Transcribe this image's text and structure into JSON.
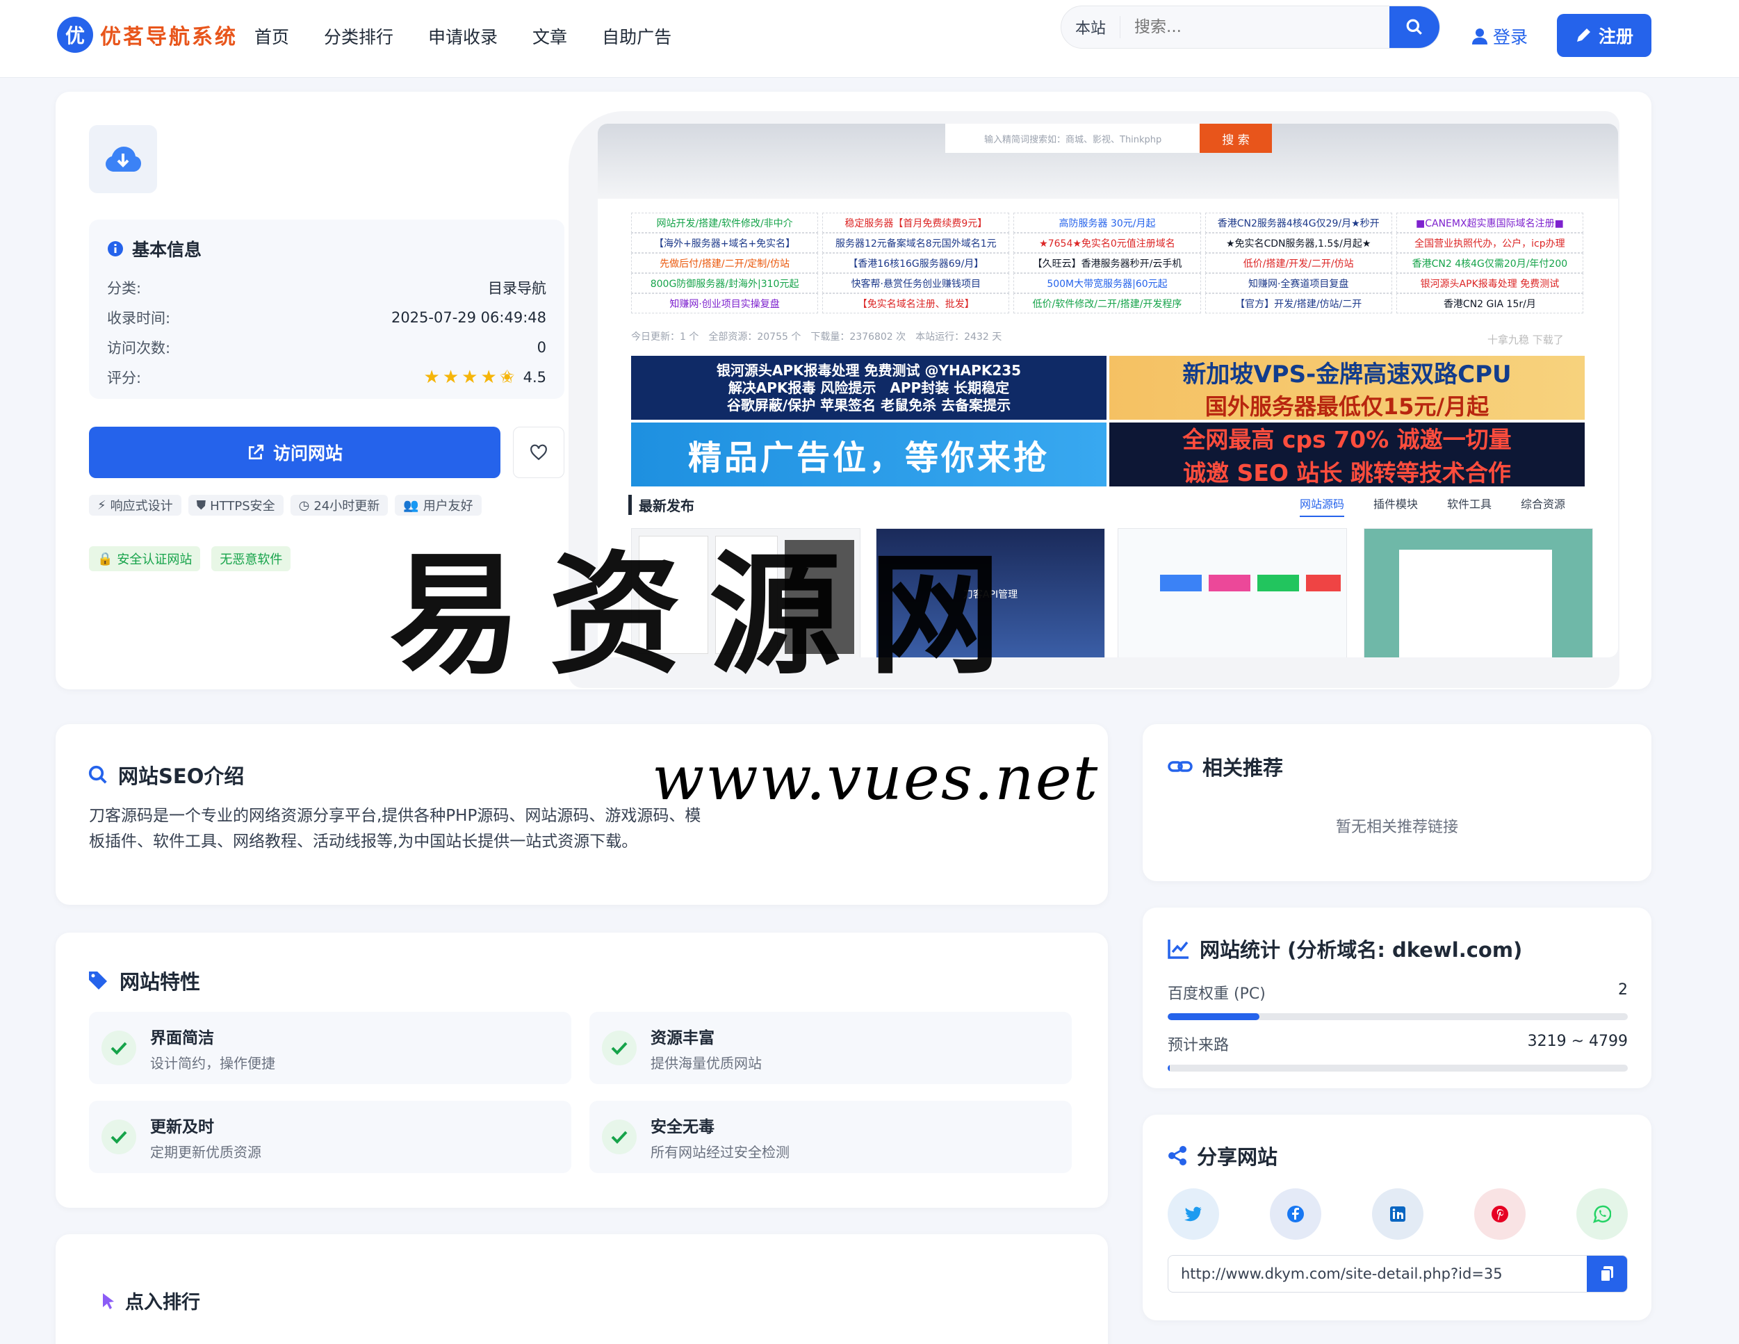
{
  "brand": {
    "badge": "优",
    "name": "优茗导航系统",
    "color": "#2563eb",
    "accent": "#e8551b"
  },
  "nav": [
    "首页",
    "分类排行",
    "申请收录",
    "文章",
    "自助广告"
  ],
  "search": {
    "scope": "本站",
    "placeholder": "搜索..."
  },
  "auth": {
    "login": "登录",
    "register": "注册"
  },
  "basic": {
    "title": "基本信息",
    "rows": [
      {
        "k": "分类:",
        "v": "目录导航"
      },
      {
        "k": "收录时间:",
        "v": "2025-07-29 06:49:48"
      },
      {
        "k": "访问次数:",
        "v": "0"
      },
      {
        "k": "评分:",
        "v": "4.5"
      }
    ],
    "rating": 4.5
  },
  "visit": {
    "label": "访问网站"
  },
  "tags": [
    "响应式设计",
    "HTTPS安全",
    "24小时更新",
    "用户友好"
  ],
  "badges": [
    "安全认证网站",
    "无恶意软件"
  ],
  "preview": {
    "search_placeholder": "输入精简词搜索如：商城、影视、Thinkphp",
    "search_btn": "搜 索",
    "links": [
      "网站开发/搭建/软件修改/非中介",
      "稳定服务器【首月免费续费9元】",
      "高防服务器 30元/月起",
      "香港CN2服务器4核4G仅29/月★秒开",
      "■CANEMX超实惠国际域名注册■",
      "【海外+服务器+域名+免实名】",
      "服务器12元备案域名8元国外域名1元",
      "★7654★免实名0元值注册域名",
      "★免实名CDN服务器,1.5$/月起★",
      "全国营业执照代办，公户，icp办理",
      "先做后付/搭建/二开/定制/仿站",
      "【香港16核16G服务器69/月】",
      "【久旺云】香港服务器秒开/云手机",
      "低价/搭建/开发/二开/仿站",
      "香港CN2 4核4G仅需20月/年付200",
      "800G防御服务器/封海外|310元起",
      "快客帮·悬赏任务创业赚钱项目",
      "500M大带宽服务器|60元起",
      "知赚网·全赛道项目复盘",
      "银河源头APK报毒处理 免费测试",
      "知赚网·创业项目实操复盘",
      "【免实名域名注册、批发】",
      "低价/软件修改/二开/搭建/开发程序",
      "【官方】开发/搭建/仿站/二开",
      "香港CN2 GIA 15r/月"
    ],
    "link_colors": [
      "#16a34a",
      "#dc2626",
      "#2563eb",
      "#1e3a8a",
      "#7e22ce",
      "#1e3a8a",
      "#1e3a8a",
      "#dc2626",
      "#111827",
      "#dc2626",
      "#ea580c",
      "#1e3a8a",
      "#111827",
      "#dc2626",
      "#16a34a",
      "#16a34a",
      "#1e3a8a",
      "#2563eb",
      "#1e3a8a",
      "#dc2626",
      "#7e22ce",
      "#dc2626",
      "#16a34a",
      "#1e3a8a",
      "#111827"
    ],
    "stat": "今日更新：1 个　全部资源：20755 个　下载量：2376802 次　本站运行：2432 天",
    "stat_right": "十拿九稳 下载了",
    "ad1": "银河源头APK报毒处理 免费测试 @YHAPK235\n解决APK报毒 风险提示　APP封装 长期稳定\n谷歌屏蔽/保护 苹果签名 老鼠免杀 去备案提示",
    "ad2a": "新加坡VPS-金牌高速双路CPU",
    "ad2b": "国外服务器最低仅15元/月起",
    "ad3": "精品广告位，等你来抢",
    "ad4a": "全网最高 cps 70% 诚邀一切量",
    "ad4b": "诚邀 SEO 站长 跳转等技术合作",
    "newpub": "最新发布",
    "tabs": [
      "网站源码",
      "插件模块",
      "软件工具",
      "综合资源"
    ],
    "thumb2": "刀客API管理"
  },
  "seo": {
    "title": "网站SEO介绍",
    "text": "刀客源码是一个专业的网络资源分享平台,提供各种PHP源码、网站源码、游戏源码、模板插件、软件工具、网络教程、活动线报等,为中国站长提供一站式资源下载。"
  },
  "features": {
    "title": "网站特性",
    "items": [
      {
        "t": "界面简洁",
        "d": "设计简约，操作便捷"
      },
      {
        "t": "资源丰富",
        "d": "提供海量优质网站"
      },
      {
        "t": "更新及时",
        "d": "定期更新优质资源"
      },
      {
        "t": "安全无毒",
        "d": "所有网站经过安全检测"
      }
    ]
  },
  "rank": {
    "title": "点入排行"
  },
  "related": {
    "title": "相关推荐",
    "empty": "暂无相关推荐链接"
  },
  "stats": {
    "title": "网站统计 (分析域名: dkewl.com)",
    "baidu_label": "百度权重 (PC)",
    "baidu_value": "2",
    "baidu_fill": 0.2,
    "traffic_label": "预计来路",
    "traffic_value": "3219 ~ 4799",
    "traffic_fill": 0.005
  },
  "share": {
    "title": "分享网站",
    "icons": [
      "twitter-icon",
      "facebook-icon",
      "linkedin-icon",
      "pinterest-icon",
      "whatsapp-icon"
    ],
    "url": "http://www.dkym.com/site-detail.php?id=35"
  },
  "watermark": {
    "cn": "易资源网",
    "url": "www.vues.net"
  }
}
